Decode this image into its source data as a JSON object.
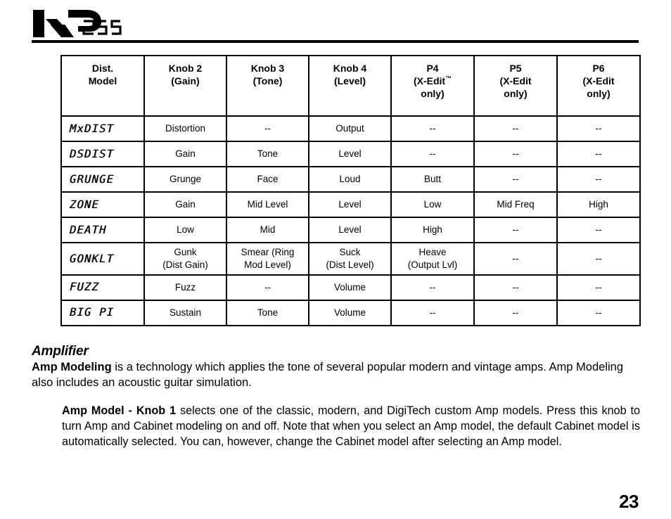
{
  "header": {
    "logo_text": "RP",
    "logo_model": "255"
  },
  "table": {
    "columns": [
      {
        "id": "model",
        "lines": [
          "Dist.",
          "Model"
        ]
      },
      {
        "id": "knob2",
        "lines": [
          "Knob 2",
          "(Gain)"
        ]
      },
      {
        "id": "knob3",
        "lines": [
          "Knob 3",
          "(Tone)"
        ]
      },
      {
        "id": "knob4",
        "lines": [
          "Knob 4",
          "(Level)"
        ]
      },
      {
        "id": "p4",
        "lines": [
          "P4",
          "(X-Edit™",
          "only)"
        ]
      },
      {
        "id": "p5",
        "lines": [
          "P5",
          "(X-Edit",
          "only)"
        ]
      },
      {
        "id": "p6",
        "lines": [
          "P6",
          "(X-Edit",
          "only)"
        ]
      }
    ],
    "rows": [
      {
        "model": "MxDIST",
        "knob2": [
          "Distortion"
        ],
        "knob3": [
          "--"
        ],
        "knob4": [
          "Output"
        ],
        "p4": [
          "--"
        ],
        "p5": [
          "--"
        ],
        "p6": [
          "--"
        ]
      },
      {
        "model": "DSDIST",
        "knob2": [
          "Gain"
        ],
        "knob3": [
          "Tone"
        ],
        "knob4": [
          "Level"
        ],
        "p4": [
          "--"
        ],
        "p5": [
          "--"
        ],
        "p6": [
          "--"
        ]
      },
      {
        "model": "GRUNGE",
        "knob2": [
          "Grunge"
        ],
        "knob3": [
          "Face"
        ],
        "knob4": [
          "Loud"
        ],
        "p4": [
          "Butt"
        ],
        "p5": [
          "--"
        ],
        "p6": [
          "--"
        ]
      },
      {
        "model": "ZONE",
        "knob2": [
          "Gain"
        ],
        "knob3": [
          "Mid Level"
        ],
        "knob4": [
          "Level"
        ],
        "p4": [
          "Low"
        ],
        "p5": [
          "Mid Freq"
        ],
        "p6": [
          "High"
        ]
      },
      {
        "model": "DEATH",
        "knob2": [
          "Low"
        ],
        "knob3": [
          "Mid"
        ],
        "knob4": [
          "Level"
        ],
        "p4": [
          "High"
        ],
        "p5": [
          "--"
        ],
        "p6": [
          "--"
        ]
      },
      {
        "model": "GONKLT",
        "knob2": [
          "Gunk",
          "(Dist Gain)"
        ],
        "knob3": [
          "Smear (Ring",
          "Mod Level)"
        ],
        "knob4": [
          "Suck",
          "(Dist Level)"
        ],
        "p4": [
          "Heave",
          "(Output Lvl)"
        ],
        "p5": [
          "--"
        ],
        "p6": [
          "--"
        ]
      },
      {
        "model": "FUZZ",
        "knob2": [
          "Fuzz"
        ],
        "knob3": [
          "--"
        ],
        "knob4": [
          "Volume"
        ],
        "p4": [
          "--"
        ],
        "p5": [
          "--"
        ],
        "p6": [
          "--"
        ]
      },
      {
        "model": "BIG PI",
        "knob2": [
          "Sustain"
        ],
        "knob3": [
          "Tone"
        ],
        "knob4": [
          "Volume"
        ],
        "p4": [
          "--"
        ],
        "p5": [
          "--"
        ],
        "p6": [
          "--"
        ]
      }
    ]
  },
  "body": {
    "heading": "Amplifier",
    "paragraph1_bold": "Amp Modeling",
    "paragraph1_rest": " is a technology which applies the tone of several popular modern and vintage amps. Amp Modeling also includes an acoustic guitar simulation.",
    "paragraph2_bold": "Amp Model - Knob 1",
    "paragraph2_rest": " selects one of the classic, modern, and DigiTech custom Amp models.  Press this knob to turn Amp and Cabinet modeling on and off. Note that when you select an Amp model, the default Cabinet model is automatically selected.  You can, however, change the Cabinet model after selecting an Amp model."
  },
  "footer": {
    "page_number": "23"
  }
}
